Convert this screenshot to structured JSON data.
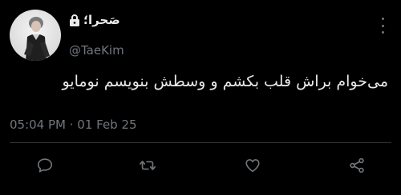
{
  "tweet": {
    "display_name": "صَحرا؛",
    "handle": "@TaeKim",
    "text": "می‌خوام براش قلب بکشم و وسطش بنویسم نومایو",
    "timestamp": "05:04 PM · 01 Feb 25",
    "protected_icon": "lock-icon",
    "avatar_icon": "profile-photo"
  },
  "actions": [
    {
      "name": "reply",
      "icon": "comment-icon"
    },
    {
      "name": "retweet",
      "icon": "retweet-icon"
    },
    {
      "name": "like",
      "icon": "heart-icon"
    },
    {
      "name": "share",
      "icon": "share-icon"
    }
  ],
  "colors": {
    "background": "#000000",
    "text": "#e7e9ea",
    "secondary": "#71767b",
    "divider": "#2f3336"
  }
}
